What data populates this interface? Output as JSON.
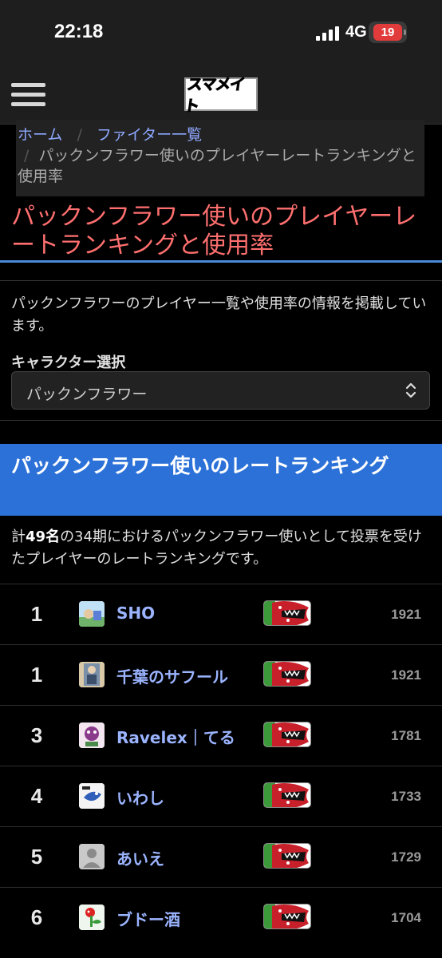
{
  "status_bar": {
    "time": "22:18",
    "network": "4G",
    "battery": "19",
    "battery_color": "#e23b3b"
  },
  "header": {
    "logo_text": "スマメイト",
    "menu_icon": "hamburger-menu-icon"
  },
  "breadcrumb": {
    "items": [
      "ホーム",
      "ファイター一覧"
    ],
    "current": "パックンフラワー使いのプレイヤーレートランキングと使用率",
    "separator": "/"
  },
  "page": {
    "title": "パックンフラワー使いのプレイヤーレートランキングと使用率",
    "intro": "パックンフラワーのプレイヤー一覧や使用率の情報を掲載しています。",
    "accent_color": "#ff6f6f"
  },
  "character_select": {
    "label": "キャラクター選択",
    "value": "パックンフラワー"
  },
  "ranking_section": {
    "title": "パックンフラワー使いのレートランキング",
    "summary_pre": "計",
    "summary_count": "49名",
    "summary_post": "の34期におけるパックンフラワー使いとして投票を受けたプレイヤーのレートランキングです。",
    "banner_color": "#2c71d8"
  },
  "ranking": [
    {
      "rank": "1",
      "name": "SHO",
      "rating": "1921"
    },
    {
      "rank": "1",
      "name": "千葉のサフール",
      "rating": "1921"
    },
    {
      "rank": "3",
      "name": "Ravelex｜てる",
      "rating": "1781"
    },
    {
      "rank": "4",
      "name": "いわし",
      "rating": "1733"
    },
    {
      "rank": "5",
      "name": "あいえ",
      "rating": "1729"
    },
    {
      "rank": "6",
      "name": "ブドー酒",
      "rating": "1704"
    }
  ]
}
